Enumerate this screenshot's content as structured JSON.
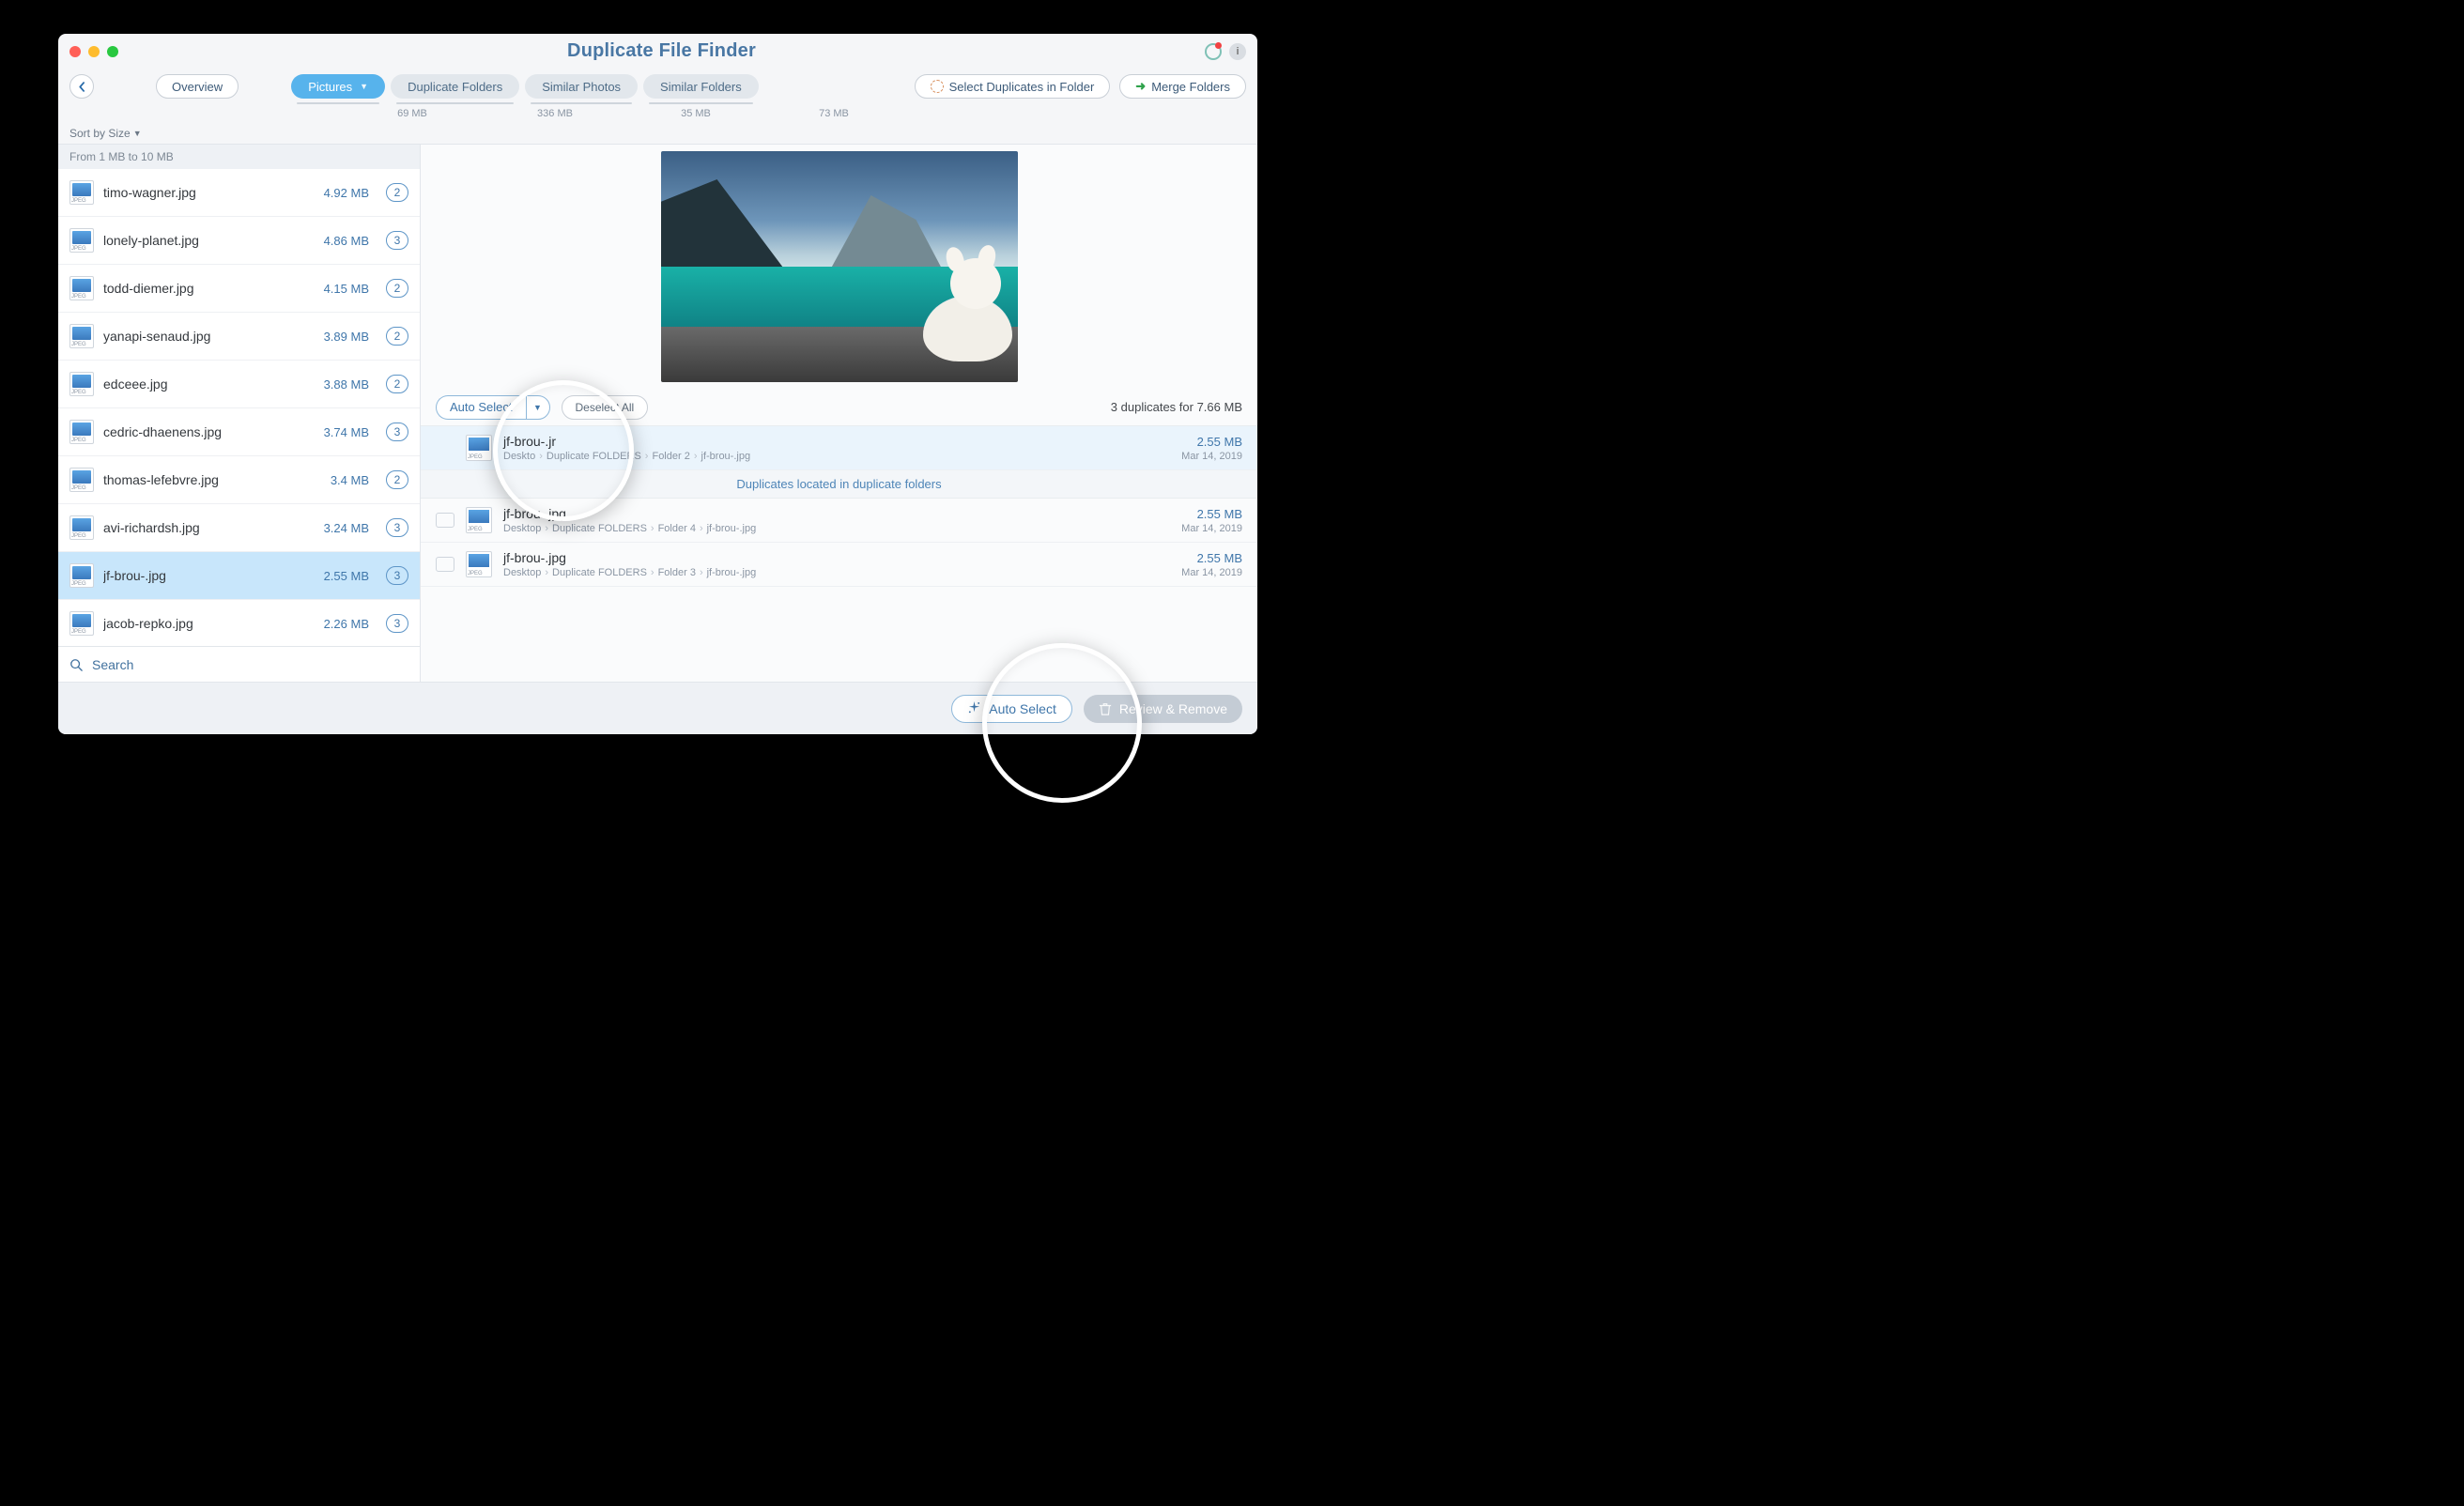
{
  "window": {
    "title": "Duplicate File Finder"
  },
  "toolbar": {
    "back_aria": "Back",
    "overview_label": "Overview",
    "tabs": [
      {
        "label": "Pictures",
        "size": "69 MB",
        "active": true,
        "has_caret": true
      },
      {
        "label": "Duplicate Folders",
        "size": "336 MB"
      },
      {
        "label": "Similar Photos",
        "size": "35 MB"
      },
      {
        "label": "Similar Folders",
        "size": "73 MB"
      }
    ],
    "select_in_folder_label": "Select Duplicates in Folder",
    "merge_folders_label": "Merge Folders"
  },
  "sort": {
    "label": "Sort by Size"
  },
  "sidebar": {
    "group_header": "From 1 MB to 10 MB",
    "search_placeholder": "Search",
    "files": [
      {
        "name": "timo-wagner.jpg",
        "size": "4.92 MB",
        "count": "2"
      },
      {
        "name": "lonely-planet.jpg",
        "size": "4.86 MB",
        "count": "3"
      },
      {
        "name": "todd-diemer.jpg",
        "size": "4.15 MB",
        "count": "2"
      },
      {
        "name": "yanapi-senaud.jpg",
        "size": "3.89 MB",
        "count": "2"
      },
      {
        "name": "edceee.jpg",
        "size": "3.88 MB",
        "count": "2"
      },
      {
        "name": "cedric-dhaenens.jpg",
        "size": "3.74 MB",
        "count": "3"
      },
      {
        "name": "thomas-lefebvre.jpg",
        "size": "3.4 MB",
        "count": "2"
      },
      {
        "name": "avi-richardsh.jpg",
        "size": "3.24 MB",
        "count": "3"
      },
      {
        "name": "jf-brou-.jpg",
        "size": "2.55 MB",
        "count": "3",
        "selected": true
      },
      {
        "name": "jacob-repko.jpg",
        "size": "2.26 MB",
        "count": "3"
      }
    ]
  },
  "detail": {
    "auto_select_label": "Auto Select",
    "deselect_all_label": "Deselect All",
    "summary": "3 duplicates for 7.66 MB",
    "band_label": "Duplicates located in duplicate folders",
    "rows": [
      {
        "name": "jf-brou-.jpg",
        "path": [
          "Desktop",
          "Duplicate FOLDERS",
          "Folder 2",
          "jf-brou-.jpg"
        ],
        "size": "2.55 MB",
        "date": "Mar 14, 2019",
        "selected": true,
        "show_folder_icon": false,
        "truncated_name": "jf-brou-.jr",
        "truncated_first": "Deskto"
      },
      {
        "name": "jf-brou-.jpg",
        "path": [
          "Desktop",
          "Duplicate FOLDERS",
          "Folder 4",
          "jf-brou-.jpg"
        ],
        "size": "2.55 MB",
        "date": "Mar 14, 2019",
        "show_folder_icon": true
      },
      {
        "name": "jf-brou-.jpg",
        "path": [
          "Desktop",
          "Duplicate FOLDERS",
          "Folder 3",
          "jf-brou-.jpg"
        ],
        "size": "2.55 MB",
        "date": "Mar 14, 2019",
        "show_folder_icon": true
      }
    ]
  },
  "footer": {
    "auto_select_label": "Auto Select",
    "review_label": "Review & Remove"
  }
}
